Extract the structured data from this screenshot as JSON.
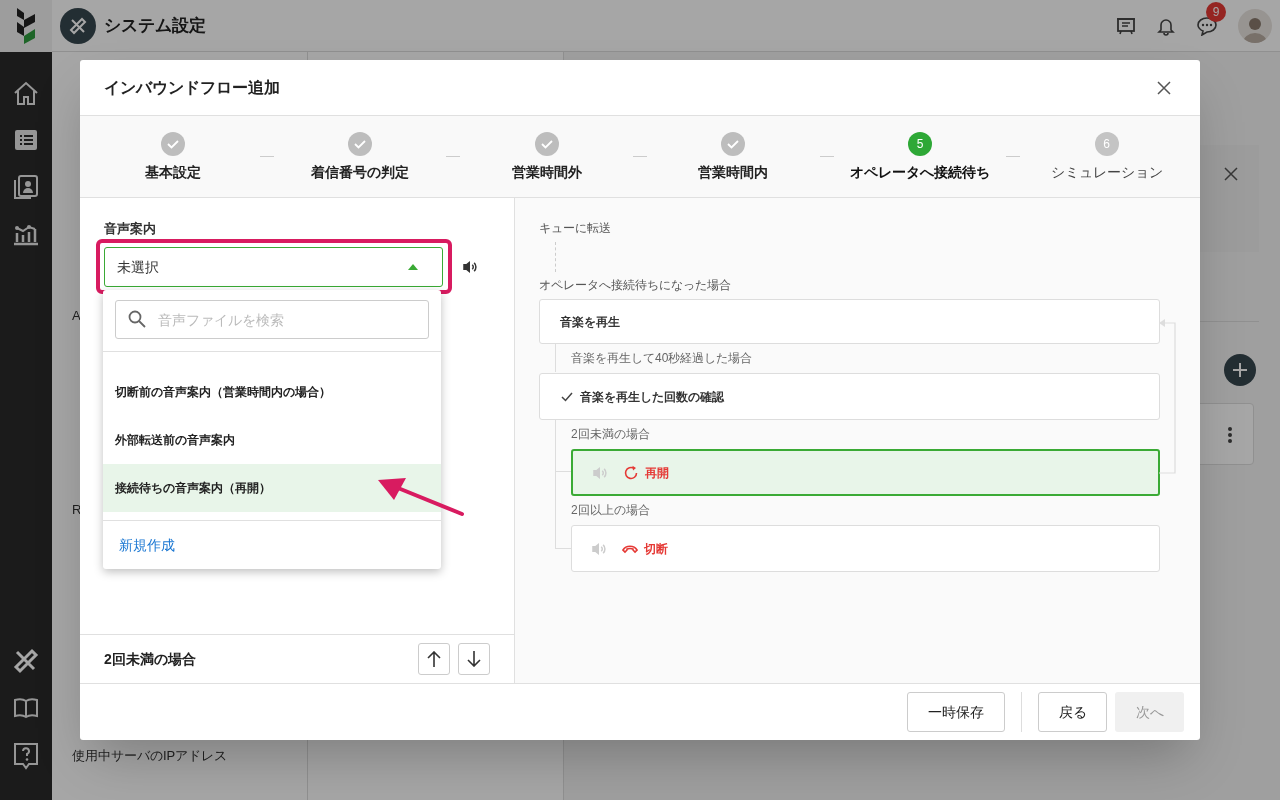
{
  "app": {
    "title": "システム設定",
    "badge": "9"
  },
  "background_menu": [
    "A",
    "R",
    "使用中サーバのIPアドレス"
  ],
  "modal": {
    "title": "インバウンドフロー追加",
    "steps": [
      {
        "label": "基本設定",
        "kind": "done",
        "selected": false
      },
      {
        "label": "着信番号の判定",
        "kind": "done",
        "selected": false
      },
      {
        "label": "営業時間外",
        "kind": "done",
        "selected": false
      },
      {
        "label": "営業時間内",
        "kind": "done",
        "selected": false
      },
      {
        "label": "オペレータへ接続待ち",
        "kind": "current",
        "number": "5",
        "selected": true
      },
      {
        "label": "シミュレーション",
        "kind": "todo",
        "number": "6",
        "selected": false
      }
    ],
    "field_label": "音声案内",
    "select": {
      "value": "未選択",
      "expanded": true,
      "highlighted": true
    },
    "search": {
      "placeholder": "音声ファイルを検索"
    },
    "options": [
      {
        "label": "切断前の音声案内（営業時間内の場合）",
        "selected": false
      },
      {
        "label": "外部転送前の音声案内",
        "selected": false
      },
      {
        "label": "接続待ちの音声案内（再開）",
        "selected": true
      }
    ],
    "create_link": "新規作成",
    "pointer_arrow": true,
    "branch_title": "2回未満の場合",
    "flow": [
      {
        "kind": "transfer",
        "text": "キューに転送"
      },
      {
        "kind": "caption",
        "text": "オペレータへ接続待ちになった場合"
      },
      {
        "kind": "step",
        "text": "音楽を再生"
      },
      {
        "kind": "subcaption",
        "text": "音楽を再生して40秒経過した場合"
      },
      {
        "kind": "check",
        "text": "音楽を再生した回数の確認"
      },
      {
        "kind": "subcaption",
        "text": "2回未満の場合"
      },
      {
        "kind": "restart",
        "text": "再開",
        "selected": true
      },
      {
        "kind": "subcaption",
        "text": "2回以上の場合"
      },
      {
        "kind": "hangup",
        "text": "切断",
        "selected": false
      }
    ],
    "buttons": [
      {
        "label": "一時保存",
        "disabled": false
      },
      {
        "label": "戻る",
        "disabled": false
      },
      {
        "label": "次へ",
        "disabled": true
      }
    ]
  }
}
